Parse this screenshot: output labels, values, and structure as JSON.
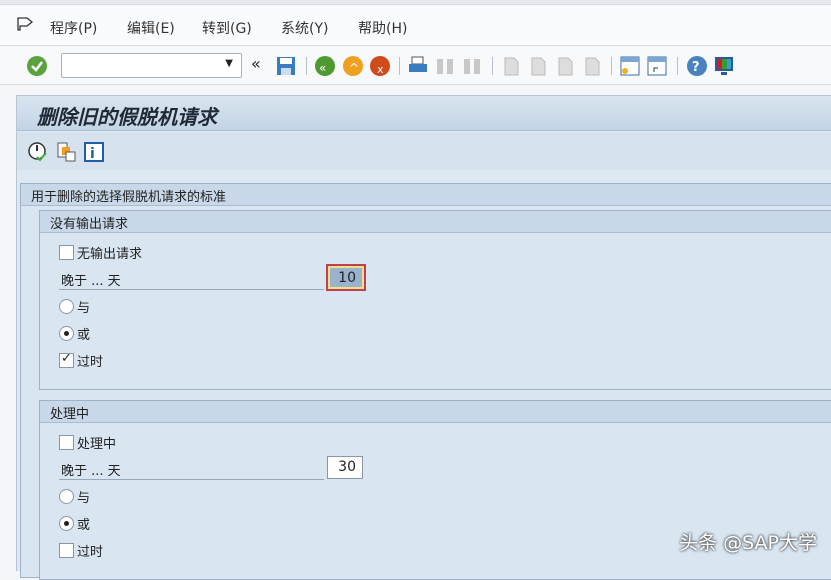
{
  "menu": [
    "程序(P)",
    "编辑(E)",
    "转到(G)",
    "系统(Y)",
    "帮助(H)"
  ],
  "command_field": {
    "value": ""
  },
  "title": "删除旧的假脱机请求",
  "criteria_group": "用于删除的选择假脱机请求的标准",
  "group1": {
    "title": "没有输出请求",
    "checkbox_label": "无输出请求",
    "days_label": "晚于 ... 天",
    "days_value": "10",
    "and_label": "与",
    "or_label": "或",
    "obsolete_label": "过时"
  },
  "group2": {
    "title": "处理中",
    "checkbox_label": "处理中",
    "days_label": "晚于 ... 天",
    "days_value": "30",
    "and_label": "与",
    "or_label": "或",
    "obsolete_label": "过时"
  },
  "watermark": "头条 @SAP大学"
}
